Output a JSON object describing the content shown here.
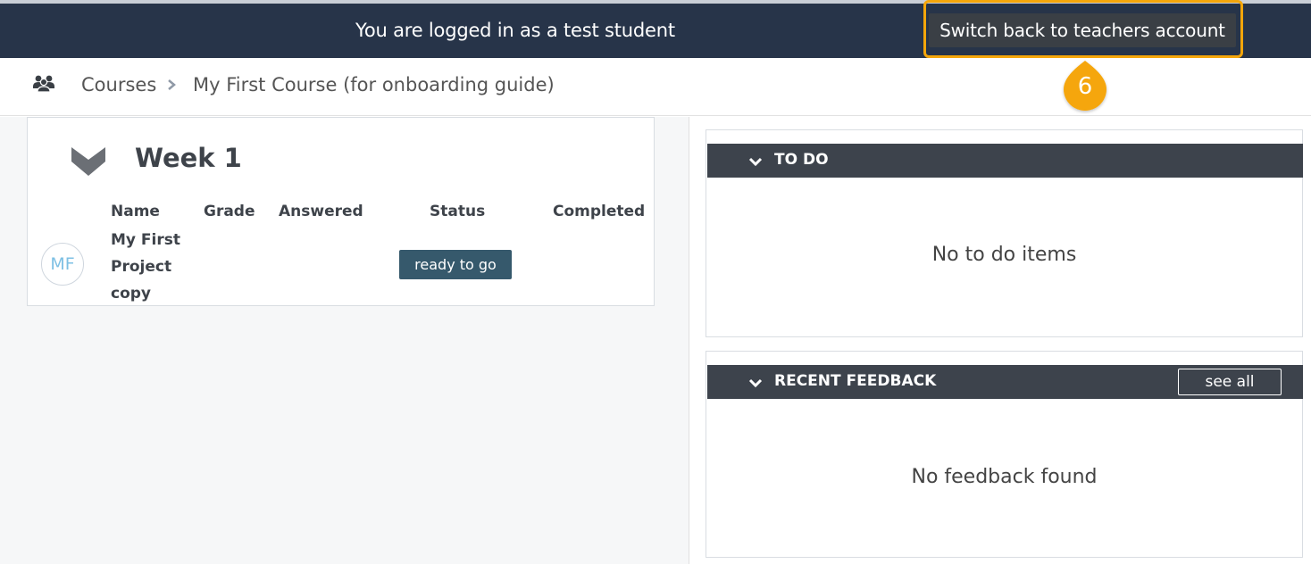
{
  "banner": {
    "message": "You are logged in as a test student",
    "switch_label": "Switch back to teachers account",
    "highlight_color": "#f5a60a",
    "background_color": "#273449"
  },
  "step_marker": {
    "number": "6",
    "color": "#f5a60a"
  },
  "breadcrumb": {
    "icon": "users-icon",
    "items": [
      "Courses",
      "My First Course (for onboarding guide)"
    ],
    "separator_icon": "chevron-right-icon"
  },
  "week": {
    "title": "Week 1",
    "columns": [
      "Name",
      "Grade",
      "Answered",
      "Status",
      "Completed"
    ],
    "rows": [
      {
        "avatar": "MF",
        "name": "My First Project copy",
        "grade": "",
        "answered": "",
        "status": "ready to go",
        "completed": ""
      }
    ]
  },
  "todo": {
    "title": "TO DO",
    "empty": "No to do items"
  },
  "feedback": {
    "title": "RECENT FEEDBACK",
    "see_all": "see all",
    "empty": "No feedback found"
  },
  "colors": {
    "panel_header": "#3d434c",
    "status_badge": "#36596c",
    "avatar_text": "#7ec0e4"
  }
}
